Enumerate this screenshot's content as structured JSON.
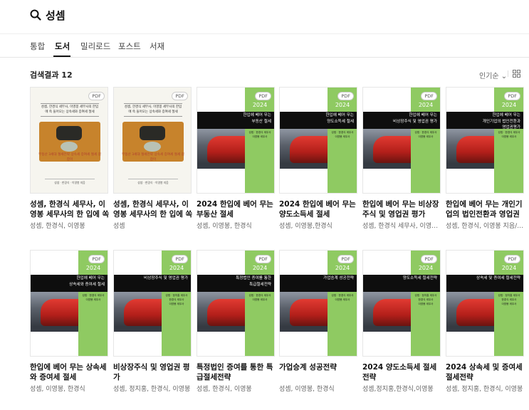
{
  "search": {
    "query": "성셈"
  },
  "tabs": [
    "통합",
    "도서",
    "밀리로드",
    "포스트",
    "서재"
  ],
  "results": {
    "count_label": "검색결과 12",
    "sort_label": "인기순 ⌄"
  },
  "books": [
    {
      "title": "성셈, 한경식 세무사, 이영봉 세무사의 한 입에 쏙 들어오는 상속세와 증여세 절세",
      "author": "성셈, 한경식, 이영봉",
      "badge": "PDF",
      "cover": "photo",
      "cover_headline": "성셈, 한경식 세무사, 이영봉 세무사의 한입에 쏙 들어오는 상속세와 증여세 절세",
      "cover_sub": "부동산 3세대 절세전략 상속세 증여세 절세 길잡이",
      "cover_foot": "성셈 · 한경식 · 이영봉 지음"
    },
    {
      "title": "성셈, 한경식 세무사, 이영봉 세무사의 한 입에 쏙 들어오는 상속세와 증여세 절세",
      "author": "성셈",
      "badge": "PDF",
      "cover": "photo",
      "cover_headline": "성셈, 한경식 세무사, 이영봉 세무사의 한입에 쏙 들어오는 상속세와 증여세 절세",
      "cover_sub": "부동산 3세대 절세전략 상속세 증여세 절세 길잡이",
      "cover_foot": "성셈 · 한경식 · 이영봉 지음"
    },
    {
      "title": "2024 한입에 베어 무는 부동산 절세",
      "author": "성셈, 이영봉, 한경식",
      "badge": "PDF",
      "cover": "train",
      "cover_year": "2024",
      "cover_band": "한입에 베어 무는\n부동산 절세",
      "cover_authors": "성셈 · 한경식 세무사\n이영봉 세무사"
    },
    {
      "title": "2024 한입에 베어 무는 양도소득세 절세",
      "author": "성셈, 이영봉,한경식",
      "badge": "PDF",
      "cover": "train",
      "cover_year": "2024",
      "cover_band": "한입에 베어 무는\n양도소득세 절세",
      "cover_authors": "성셈 · 한경식 세무사\n이영봉 세무사"
    },
    {
      "title": "한입에 베어 무는 비상장주식 및 영업권 평가",
      "author": "성셈, 한경식 세무사, 이영봉 세무사",
      "badge": "PDF",
      "cover": "train",
      "cover_year": "2024",
      "cover_band": "한입에 베어 무는\n비상장주식 및 영업권 평가",
      "cover_authors": "성셈 · 한경식 세무사\n이영봉 세무사"
    },
    {
      "title": "한입에 베어 무는 개인기업의 법인전환과 영업권 평가",
      "author": "성셈, 한경식, 이영봉 지음/성셈 엮음",
      "badge": "PDF",
      "cover": "train",
      "cover_year": "2024",
      "cover_band": "한입에 베어 무는\n개인기업의 법인전환과\n영업권평가",
      "cover_authors": "성셈 · 한경식 세무사\n이영봉 세무사"
    },
    {
      "title": "한입에 베어 무는 상속세와 증여세 절세",
      "author": "성셈, 이영봉, 한경식",
      "badge": "PDF",
      "cover": "train",
      "cover_year": "2024",
      "cover_band": "한입에 베어 무는\n상속세와 증여세 절세",
      "cover_authors": "성셈 · 한경식 세무사\n이영봉 세무사"
    },
    {
      "title": "비상장주식 및 영업권 평가",
      "author": "성셈, 정지홍, 한경식, 이영봉",
      "badge": "PDF",
      "cover": "train",
      "cover_year": "2024",
      "cover_band": "비상장주식 및 영업권 평가",
      "cover_authors": "성셈 · 정지홍 세무사\n한경식 세무사\n이영봉 세무사"
    },
    {
      "title": "특정법인 증여를 통한 특급절세전략",
      "author": "성셈, 한경식, 이영봉",
      "badge": "PDF",
      "cover": "train",
      "cover_year": "2024",
      "cover_band": "특정법인 증여를 통한\n특급절세전략",
      "cover_authors": "성셈 · 한경식 세무사\n이영봉 세무사"
    },
    {
      "title": "가업승계 성공전략",
      "author": "성셈, 이영봉, 한경식",
      "badge": "PDF",
      "cover": "train",
      "cover_year": "2024",
      "cover_band": "가업승계 성공전략",
      "cover_authors": "성셈 · 한경식 세무사\n이영봉 세무사"
    },
    {
      "title": "2024 양도소득세 절세전략",
      "author": "성셈,정지홍,한경식,이영봉",
      "badge": "PDF",
      "cover": "train",
      "cover_year": "2024",
      "cover_band": "양도소득세 절세전략",
      "cover_authors": "성셈 · 정지홍 세무사\n한경식 세무사\n이영봉 세무사"
    },
    {
      "title": "2024 상속세 및 증여세 절세전략",
      "author": "성셈, 정지홍, 한경식, 이영봉",
      "badge": "PDF",
      "cover": "train",
      "cover_year": "2024",
      "cover_band": "상속세 및 증여세 절세전략",
      "cover_authors": "성셈 · 정지홍 세무사\n한경식 세무사\n이영봉 세무사"
    }
  ],
  "colors": {
    "accent_green": "#8fca62",
    "text_dark": "#111111",
    "text_muted": "#666666"
  }
}
